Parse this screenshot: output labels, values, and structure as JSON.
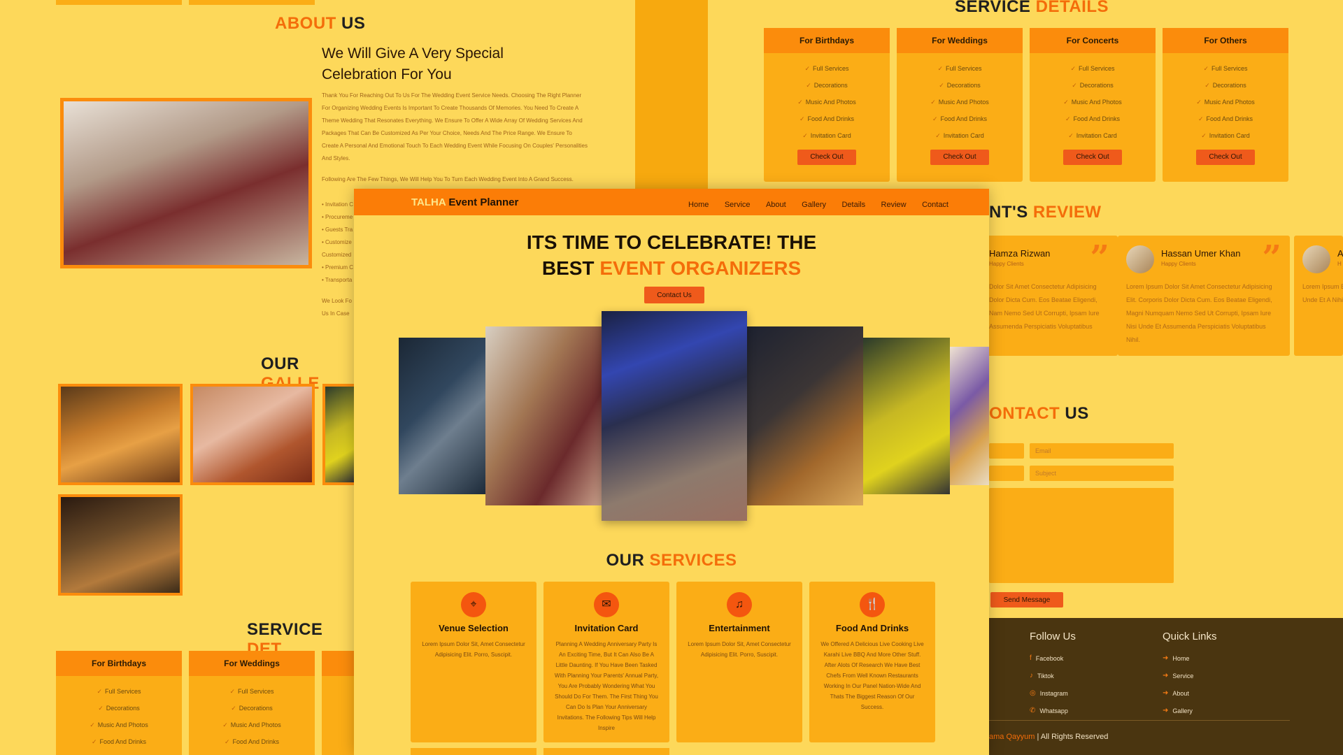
{
  "about": {
    "heading_a": "ABOUT",
    "heading_b": "US",
    "title": "We Will Give A Very Special Celebration For You",
    "para1": "Thank You For Reaching Out To Us For The Wedding Event Service Needs. Choosing The Right Planner For Organizing Wedding Events Is Important To Create Thousands Of Memories. You Need To Create A Theme Wedding That Resonates Everything. We Ensure To Offer A Wide Array Of Wedding Services And Packages That Can Be Customized As Per Your Choice, Needs And The Price Range. We Ensure To Create A Personal And Emotional Touch To Each Wedding Event While Focusing On Couples' Personalities And Styles.",
    "para2": "Following Are The Few Things, We Will Help You To Turn Each Wedding Event Into A Grand Success.",
    "bullets": [
      "• Invitation C",
      "• Procureme",
      "• Guests Tra",
      "• Customize",
      "Customized",
      "• Premium C",
      "• Transporta"
    ],
    "para3a": "We Look Fo",
    "para3b": "Us In Case"
  },
  "gallery": {
    "heading_a": "OUR",
    "heading_b": "GALLE"
  },
  "service_details_top": {
    "heading_a": "SERVICE",
    "heading_b": "DETAILS",
    "cards": [
      {
        "title": "For Birthdays",
        "items": [
          "Full Services",
          "Decorations",
          "Music And Photos",
          "Food And Drinks",
          "Invitation Card"
        ],
        "button": "Check Out"
      },
      {
        "title": "For Weddings",
        "items": [
          "Full Services",
          "Decorations",
          "Music And Photos",
          "Food And Drinks",
          "Invitation Card"
        ],
        "button": "Check Out"
      },
      {
        "title": "For Concerts",
        "items": [
          "Full Services",
          "Decorations",
          "Music And Photos",
          "Food And Drinks",
          "Invitation Card"
        ],
        "button": "Check Out"
      },
      {
        "title": "For Others",
        "items": [
          "Full Services",
          "Decorations",
          "Music And Photos",
          "Food And Drinks",
          "Invitation Card"
        ],
        "button": "Check Out"
      }
    ]
  },
  "service_details_bottom": {
    "heading_a": "SERVICE",
    "heading_b": "DET",
    "cards": [
      {
        "title": "For Birthdays",
        "items": [
          "Full Services",
          "Decorations",
          "Music And Photos",
          "Food And Drinks"
        ]
      },
      {
        "title": "For Weddings",
        "items": [
          "Full Services",
          "Decorations",
          "Music And Photos",
          "Food And Drinks"
        ]
      }
    ]
  },
  "review": {
    "heading_a": "NT'S",
    "heading_b": "REVIEW",
    "items": [
      {
        "name": "Hamza Rizwan",
        "role": "Happy Clients",
        "text": "Dolor Sit Amet Consectetur Adipisicing Dolor Dicta Cum. Eos Beatae Eligendi, Nam Nemo Sed Ut Corrupti, Ipsam Iure Assumenda Perspiciatis Voluptatibus"
      },
      {
        "name": "Hassan Umer Khan",
        "role": "Happy Clients",
        "text": "Lorem Ipsum Dolor Sit Amet Consectetur Adipisicing Elit. Corporis Dolor Dicta Cum. Eos Beatae Eligendi, Magni Numquam Nemo Sed Ut Corrupti, Ipsam Iure Nisi Unde Et Assumenda Perspiciatis Voluptatibus Nihil."
      },
      {
        "name": "A",
        "role": "H",
        "text": "Lorem Ipsum Elit. Corporis Magni Numqu Nisi Unde Et A Nihil."
      }
    ]
  },
  "contact": {
    "heading_a": "ONTACT",
    "heading_b": "US",
    "email_placeholder": "Email",
    "subject_placeholder": "Subject",
    "send_button": "Send Message"
  },
  "footer": {
    "follow_title": "Follow Us",
    "follow_links": [
      "Facebook",
      "Tiktok",
      "Instagram",
      "Whatsapp"
    ],
    "quick_title": "Quick Links",
    "quick_links": [
      "Home",
      "Service",
      "About",
      "Gallery"
    ],
    "copyright_name": "ama Qayyum",
    "copyright_rest": " | All Rights Reserved"
  },
  "main": {
    "brand_a": "TALHA",
    "brand_b": " Event Planner",
    "nav": [
      "Home",
      "Service",
      "About",
      "Gallery",
      "Details",
      "Review",
      "Contact"
    ],
    "hero_line1": "ITS TIME TO CELEBRATE! THE",
    "hero_line2a": "BEST ",
    "hero_line2b": "EVENT ORGANIZERS",
    "contact_button": "Contact Us",
    "services_heading_a": "OUR",
    "services_heading_b": "SERVICES",
    "services": [
      {
        "icon": "location-pin-icon",
        "title": "Venue Selection",
        "text": "Lorem Ipsum Dolor Sit, Amet Consectetur Adipisicing Elit. Porro, Suscipit."
      },
      {
        "icon": "envelope-icon",
        "title": "Invitation Card",
        "text": "Planning A Wedding Anniversary Party Is An Exciting Time, But It Can Also Be A Little Daunting. If You Have Been Tasked With Planning Your Parents' Annual Party, You Are Probably Wondering What You Should Do For Them. The First Thing You Can Do Is Plan Your Anniversary Invitations. The Following Tips Will Help Inspire"
      },
      {
        "icon": "music-note-icon",
        "title": "Entertainment",
        "text": "Lorem Ipsum Dolor Sit, Amet Consectetur Adipisicing Elit. Porro, Suscipit."
      },
      {
        "icon": "utensils-icon",
        "title": "Food And Drinks",
        "text": "We Offered A Delicious Live Cooking Live Karahi Live BBQ And More Other Stuff. After Alots Of Research We Have Best Chefs From Well Known Restaurants Working In Our Panel Nation-Wide And Thats The Biggest Reason Of Our Success."
      }
    ]
  },
  "colors": {
    "accent": "#f46d0a",
    "panel": "#fdd85a",
    "card": "#fbad16",
    "header": "#fb8c0c",
    "footer_bg": "#4a3510"
  }
}
